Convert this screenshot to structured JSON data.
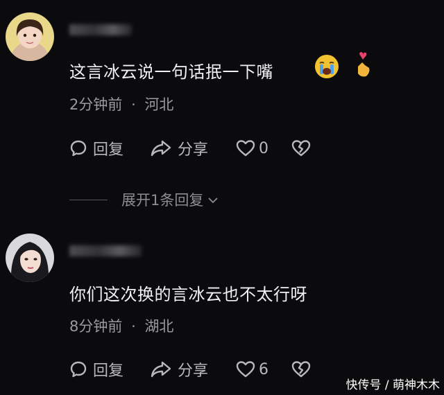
{
  "comments": [
    {
      "text": "这言冰云说一句话抿一下嘴",
      "time": "2分钟前",
      "sep": "·",
      "location": "河北",
      "reply_label": "回复",
      "share_label": "分享",
      "like_count": "0"
    },
    {
      "text": "你们这次换的言冰云也不太行呀",
      "time": "8分钟前",
      "sep": "·",
      "location": "湖北",
      "reply_label": "回复",
      "share_label": "分享",
      "like_count": "6"
    }
  ],
  "expand_replies": "展开1条回复",
  "icons": {
    "reply": "comment-bubble-icon",
    "share": "share-arrow-icon",
    "like": "heart-icon",
    "dislike": "broken-heart-icon",
    "expand": "chevron-down-icon",
    "emoji1": "crying-face-emoji",
    "emoji2": "finger-heart-emoji"
  },
  "watermark": "快传号 / 萌神木木",
  "colors": {
    "background": "#0b0b0d",
    "text": "#f2f2f4",
    "muted": "#9a9aa0"
  }
}
